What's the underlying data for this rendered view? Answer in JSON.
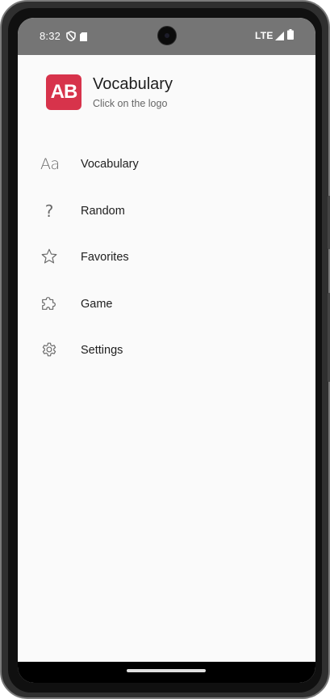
{
  "status_bar": {
    "time": "8:32",
    "network": "LTE",
    "icons": [
      "shield-icon",
      "sd-card-icon",
      "signal-icon",
      "battery-icon"
    ]
  },
  "header": {
    "logo_text": "AB",
    "logo_color": "#d7334b",
    "title": "Vocabulary",
    "subtitle": "Click on the logo"
  },
  "menu": {
    "items": [
      {
        "label": "Vocabulary",
        "icon": "text-aa-icon",
        "glyph": "Aa"
      },
      {
        "label": "Random",
        "icon": "question-mark-icon",
        "glyph": "?"
      },
      {
        "label": "Favorites",
        "icon": "star-icon"
      },
      {
        "label": "Game",
        "icon": "puzzle-icon"
      },
      {
        "label": "Settings",
        "icon": "gear-icon"
      }
    ]
  },
  "colors": {
    "status_bar_bg": "#757575",
    "drawer_bg": "#fafafa",
    "icon_gray": "#6b6b6b"
  }
}
